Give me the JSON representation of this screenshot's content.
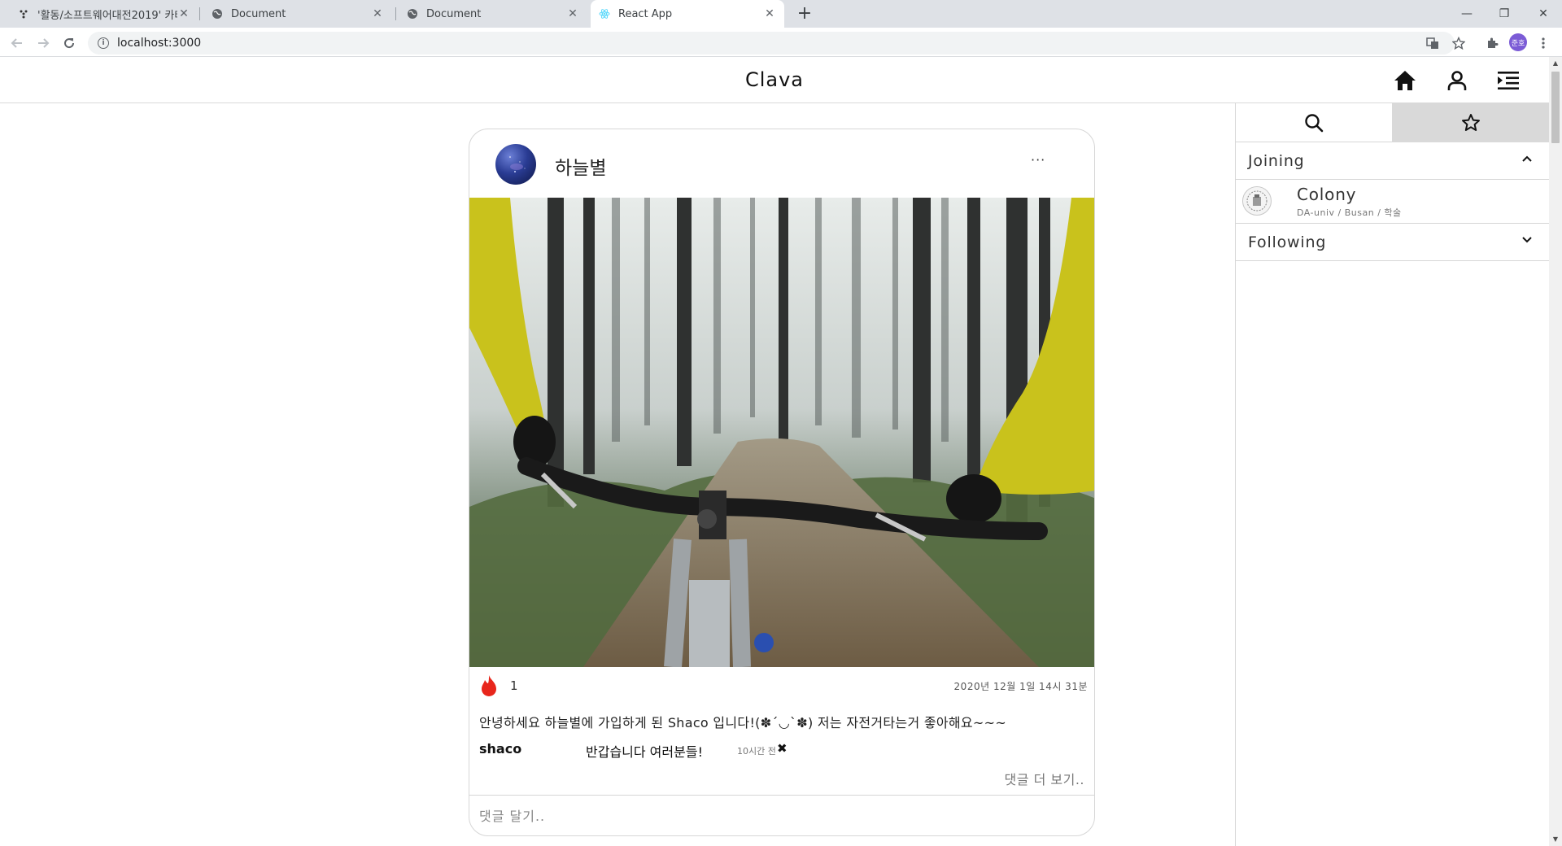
{
  "browser": {
    "tabs": [
      {
        "title": "'활동/소프트웨어대전2019' 카테",
        "close": "✕",
        "favicon": "github-icon"
      },
      {
        "title": "Document",
        "close": "✕",
        "favicon": "globe-icon"
      },
      {
        "title": "Document",
        "close": "✕",
        "favicon": "globe-icon"
      },
      {
        "title": "React App",
        "close": "✕",
        "favicon": "react-icon",
        "active": true
      }
    ],
    "new_tab": "+",
    "url": "localhost:3000",
    "profile_initials": "준호",
    "window_controls": {
      "minimize": "—",
      "restore": "❐",
      "close": "✕"
    }
  },
  "header": {
    "brand": "Clava",
    "icons": [
      "home-icon",
      "user-icon",
      "menu-indent-icon"
    ]
  },
  "post": {
    "author": "하늘별",
    "more": "···",
    "likes": "1",
    "date": "2020년 12월 1일 14시 31분",
    "caption": "안녕하세요 하늘별에 가입하게 된 Shaco 입니다!(✽´◡`✽) 저는 자전거타는거 좋아해요~~~",
    "comment": {
      "user": "shaco",
      "text": "반갑습니다 여러분들!",
      "time": "10시간 전",
      "delete": "✖"
    },
    "more_comments": "댓글 더 보기..",
    "comment_placeholder": "댓글 달기.."
  },
  "sidebar": {
    "tabs": [
      "search-icon",
      "star-icon"
    ],
    "active_tab": 1,
    "joining": {
      "label": "Joining",
      "chevron": "⌃"
    },
    "groups": [
      {
        "name": "Colony",
        "meta": "DA-univ / Busan / 학술"
      }
    ],
    "following": {
      "label": "Following",
      "chevron": "⌄"
    }
  },
  "colors": {
    "flame": "#e8261c",
    "jacket": "#c9c21c",
    "sidebar_active_tab": "#d9d9d9",
    "profile": "#7b5bd6"
  }
}
